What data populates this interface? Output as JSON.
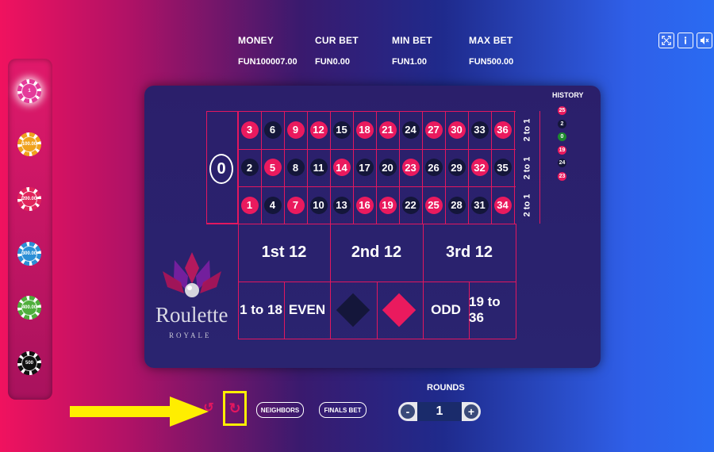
{
  "hud": {
    "money_label": "MONEY",
    "money_value": "FUN100007.00",
    "cur_bet_label": "CUR BET",
    "cur_bet_value": "FUN0.00",
    "min_bet_label": "MIN BET",
    "min_bet_value": "FUN1.00",
    "max_bet_label": "MAX BET",
    "max_bet_value": "FUN500.00"
  },
  "top_icons": [
    "fullscreen-icon",
    "info-icon",
    "mute-icon"
  ],
  "chips": [
    {
      "label": "1",
      "color": "#e43a9a"
    },
    {
      "label": "100.00",
      "color": "#f0a21e"
    },
    {
      "label": "200.00",
      "color": "#e0245b"
    },
    {
      "label": "300.00",
      "color": "#2c8fd6"
    },
    {
      "label": "400.00",
      "color": "#4fae3c"
    },
    {
      "label": "500",
      "color": "#111111"
    }
  ],
  "table": {
    "zero": "0",
    "rows": [
      [
        {
          "n": "3",
          "c": "red"
        },
        {
          "n": "6",
          "c": "black"
        },
        {
          "n": "9",
          "c": "red"
        },
        {
          "n": "12",
          "c": "red"
        },
        {
          "n": "15",
          "c": "black"
        },
        {
          "n": "18",
          "c": "red"
        },
        {
          "n": "21",
          "c": "red"
        },
        {
          "n": "24",
          "c": "black"
        },
        {
          "n": "27",
          "c": "red"
        },
        {
          "n": "30",
          "c": "red"
        },
        {
          "n": "33",
          "c": "black"
        },
        {
          "n": "36",
          "c": "red"
        }
      ],
      [
        {
          "n": "2",
          "c": "black"
        },
        {
          "n": "5",
          "c": "red"
        },
        {
          "n": "8",
          "c": "black"
        },
        {
          "n": "11",
          "c": "black"
        },
        {
          "n": "14",
          "c": "red"
        },
        {
          "n": "17",
          "c": "black"
        },
        {
          "n": "20",
          "c": "black"
        },
        {
          "n": "23",
          "c": "red"
        },
        {
          "n": "26",
          "c": "black"
        },
        {
          "n": "29",
          "c": "black"
        },
        {
          "n": "32",
          "c": "red"
        },
        {
          "n": "35",
          "c": "black"
        }
      ],
      [
        {
          "n": "1",
          "c": "red"
        },
        {
          "n": "4",
          "c": "black"
        },
        {
          "n": "7",
          "c": "red"
        },
        {
          "n": "10",
          "c": "black"
        },
        {
          "n": "13",
          "c": "black"
        },
        {
          "n": "16",
          "c": "red"
        },
        {
          "n": "19",
          "c": "red"
        },
        {
          "n": "22",
          "c": "black"
        },
        {
          "n": "25",
          "c": "red"
        },
        {
          "n": "28",
          "c": "black"
        },
        {
          "n": "31",
          "c": "black"
        },
        {
          "n": "34",
          "c": "red"
        }
      ]
    ],
    "column_bets": [
      "2 to 1",
      "2 to 1",
      "2 to 1"
    ],
    "dozens": [
      "1st 12",
      "2nd 12",
      "3rd 12"
    ],
    "outside": {
      "low": "1 to 18",
      "even": "EVEN",
      "odd": "ODD",
      "high": "19 to 36"
    },
    "colors": {
      "red": "#ea1a5e",
      "black": "#14163a",
      "line": "#e2175f"
    }
  },
  "logo": {
    "word": "Roulette",
    "sub": "ROYALE"
  },
  "history": {
    "title": "HISTORY",
    "items": [
      {
        "n": "25",
        "c": "red"
      },
      {
        "n": "2",
        "c": "black"
      },
      {
        "n": "0",
        "c": "green"
      },
      {
        "n": "19",
        "c": "red"
      },
      {
        "n": "24",
        "c": "black"
      },
      {
        "n": "23",
        "c": "red"
      }
    ]
  },
  "controls": {
    "neighbors": "NEIGHBORS",
    "finals_bet": "FINALS BET",
    "rounds_label": "ROUNDS",
    "rounds_value": "1",
    "minus": "-",
    "plus": "+"
  }
}
